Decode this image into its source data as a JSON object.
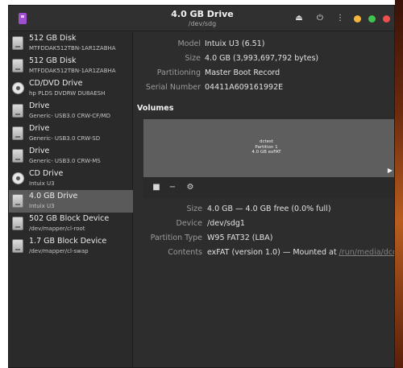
{
  "window": {
    "title": "4.0 GB Drive",
    "subtitle": "/dev/sdg",
    "buttons": {
      "eject": "⏏",
      "power": "⏻",
      "menu": "⋮"
    },
    "controls": {
      "minimize_color": "#f4b63a",
      "maximize_color": "#3fc44e",
      "close_color": "#ef4f4f"
    }
  },
  "sidebar": {
    "items": [
      {
        "name": "512 GB Disk",
        "sub": "MTFDDAK512TBN-1AR1ZABHA",
        "icon": "disk-icon"
      },
      {
        "name": "512 GB Disk",
        "sub": "MTFDDAK512TBN-1AR1ZABHA",
        "icon": "disk-icon"
      },
      {
        "name": "CD/DVD Drive",
        "sub": "hp PLDS DVDRW  DU8AESH",
        "icon": "optical-drive-icon"
      },
      {
        "name": "Drive",
        "sub": "Generic- USB3.0 CRW-CF/MD",
        "icon": "disk-icon"
      },
      {
        "name": "Drive",
        "sub": "Generic- USB3.0 CRW-SD",
        "icon": "disk-icon"
      },
      {
        "name": "Drive",
        "sub": "Generic- USB3.0 CRW-MS",
        "icon": "disk-icon"
      },
      {
        "name": "CD Drive",
        "sub": "Intuix U3",
        "icon": "cd-icon"
      },
      {
        "name": "4.0 GB Drive",
        "sub": "Intuix U3",
        "icon": "disk-icon",
        "selected": true
      },
      {
        "name": "502 GB Block Device",
        "sub": "/dev/mapper/cl-root",
        "icon": "disk-icon"
      },
      {
        "name": "1.7 GB Block Device",
        "sub": "/dev/mapper/cl-swap",
        "icon": "disk-icon"
      }
    ]
  },
  "drive": {
    "model_label": "Model",
    "model": "Intuix U3 (6.51)",
    "size_label": "Size",
    "size": "4.0 GB (3,993,697,792 bytes)",
    "partitioning_label": "Partitioning",
    "partitioning": "Master Boot Record",
    "serial_label": "Serial Number",
    "serial": "04411A609161992E"
  },
  "volumes": {
    "heading": "Volumes",
    "partition": {
      "name": "dctest",
      "number": "Partition 1",
      "desc": "4.0 GB exFAT"
    },
    "details": {
      "size_label": "Size",
      "size": "4.0 GB — 4.0 GB free (0.0% full)",
      "device_label": "Device",
      "device": "/dev/sdg1",
      "type_label": "Partition Type",
      "type": "W95 FAT32 (LBA)",
      "contents_label": "Contents",
      "contents": "exFAT (version 1.0) — Mounted at ",
      "mount_link": "/run/media/dconi..."
    }
  }
}
